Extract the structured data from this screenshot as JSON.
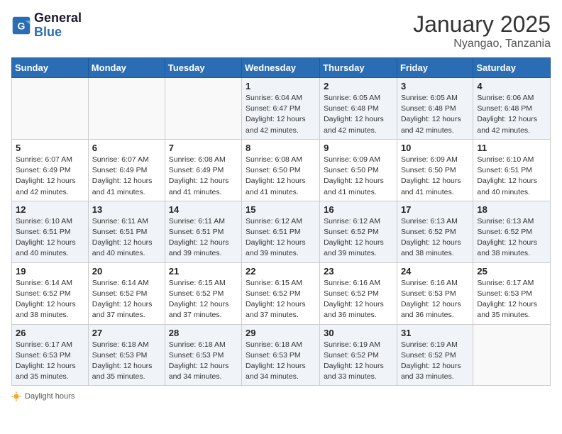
{
  "header": {
    "logo_line1": "General",
    "logo_line2": "Blue",
    "month_title": "January 2025",
    "location": "Nyangao, Tanzania"
  },
  "days_of_week": [
    "Sunday",
    "Monday",
    "Tuesday",
    "Wednesday",
    "Thursday",
    "Friday",
    "Saturday"
  ],
  "weeks": [
    [
      {
        "day": "",
        "info": ""
      },
      {
        "day": "",
        "info": ""
      },
      {
        "day": "",
        "info": ""
      },
      {
        "day": "1",
        "info": "Sunrise: 6:04 AM\nSunset: 6:47 PM\nDaylight: 12 hours\nand 42 minutes."
      },
      {
        "day": "2",
        "info": "Sunrise: 6:05 AM\nSunset: 6:48 PM\nDaylight: 12 hours\nand 42 minutes."
      },
      {
        "day": "3",
        "info": "Sunrise: 6:05 AM\nSunset: 6:48 PM\nDaylight: 12 hours\nand 42 minutes."
      },
      {
        "day": "4",
        "info": "Sunrise: 6:06 AM\nSunset: 6:48 PM\nDaylight: 12 hours\nand 42 minutes."
      }
    ],
    [
      {
        "day": "5",
        "info": "Sunrise: 6:07 AM\nSunset: 6:49 PM\nDaylight: 12 hours\nand 42 minutes."
      },
      {
        "day": "6",
        "info": "Sunrise: 6:07 AM\nSunset: 6:49 PM\nDaylight: 12 hours\nand 41 minutes."
      },
      {
        "day": "7",
        "info": "Sunrise: 6:08 AM\nSunset: 6:49 PM\nDaylight: 12 hours\nand 41 minutes."
      },
      {
        "day": "8",
        "info": "Sunrise: 6:08 AM\nSunset: 6:50 PM\nDaylight: 12 hours\nand 41 minutes."
      },
      {
        "day": "9",
        "info": "Sunrise: 6:09 AM\nSunset: 6:50 PM\nDaylight: 12 hours\nand 41 minutes."
      },
      {
        "day": "10",
        "info": "Sunrise: 6:09 AM\nSunset: 6:50 PM\nDaylight: 12 hours\nand 41 minutes."
      },
      {
        "day": "11",
        "info": "Sunrise: 6:10 AM\nSunset: 6:51 PM\nDaylight: 12 hours\nand 40 minutes."
      }
    ],
    [
      {
        "day": "12",
        "info": "Sunrise: 6:10 AM\nSunset: 6:51 PM\nDaylight: 12 hours\nand 40 minutes."
      },
      {
        "day": "13",
        "info": "Sunrise: 6:11 AM\nSunset: 6:51 PM\nDaylight: 12 hours\nand 40 minutes."
      },
      {
        "day": "14",
        "info": "Sunrise: 6:11 AM\nSunset: 6:51 PM\nDaylight: 12 hours\nand 39 minutes."
      },
      {
        "day": "15",
        "info": "Sunrise: 6:12 AM\nSunset: 6:51 PM\nDaylight: 12 hours\nand 39 minutes."
      },
      {
        "day": "16",
        "info": "Sunrise: 6:12 AM\nSunset: 6:52 PM\nDaylight: 12 hours\nand 39 minutes."
      },
      {
        "day": "17",
        "info": "Sunrise: 6:13 AM\nSunset: 6:52 PM\nDaylight: 12 hours\nand 38 minutes."
      },
      {
        "day": "18",
        "info": "Sunrise: 6:13 AM\nSunset: 6:52 PM\nDaylight: 12 hours\nand 38 minutes."
      }
    ],
    [
      {
        "day": "19",
        "info": "Sunrise: 6:14 AM\nSunset: 6:52 PM\nDaylight: 12 hours\nand 38 minutes."
      },
      {
        "day": "20",
        "info": "Sunrise: 6:14 AM\nSunset: 6:52 PM\nDaylight: 12 hours\nand 37 minutes."
      },
      {
        "day": "21",
        "info": "Sunrise: 6:15 AM\nSunset: 6:52 PM\nDaylight: 12 hours\nand 37 minutes."
      },
      {
        "day": "22",
        "info": "Sunrise: 6:15 AM\nSunset: 6:52 PM\nDaylight: 12 hours\nand 37 minutes."
      },
      {
        "day": "23",
        "info": "Sunrise: 6:16 AM\nSunset: 6:52 PM\nDaylight: 12 hours\nand 36 minutes."
      },
      {
        "day": "24",
        "info": "Sunrise: 6:16 AM\nSunset: 6:53 PM\nDaylight: 12 hours\nand 36 minutes."
      },
      {
        "day": "25",
        "info": "Sunrise: 6:17 AM\nSunset: 6:53 PM\nDaylight: 12 hours\nand 35 minutes."
      }
    ],
    [
      {
        "day": "26",
        "info": "Sunrise: 6:17 AM\nSunset: 6:53 PM\nDaylight: 12 hours\nand 35 minutes."
      },
      {
        "day": "27",
        "info": "Sunrise: 6:18 AM\nSunset: 6:53 PM\nDaylight: 12 hours\nand 35 minutes."
      },
      {
        "day": "28",
        "info": "Sunrise: 6:18 AM\nSunset: 6:53 PM\nDaylight: 12 hours\nand 34 minutes."
      },
      {
        "day": "29",
        "info": "Sunrise: 6:18 AM\nSunset: 6:53 PM\nDaylight: 12 hours\nand 34 minutes."
      },
      {
        "day": "30",
        "info": "Sunrise: 6:19 AM\nSunset: 6:52 PM\nDaylight: 12 hours\nand 33 minutes."
      },
      {
        "day": "31",
        "info": "Sunrise: 6:19 AM\nSunset: 6:52 PM\nDaylight: 12 hours\nand 33 minutes."
      },
      {
        "day": "",
        "info": ""
      }
    ]
  ],
  "footer": {
    "daylight_label": "Daylight hours"
  }
}
